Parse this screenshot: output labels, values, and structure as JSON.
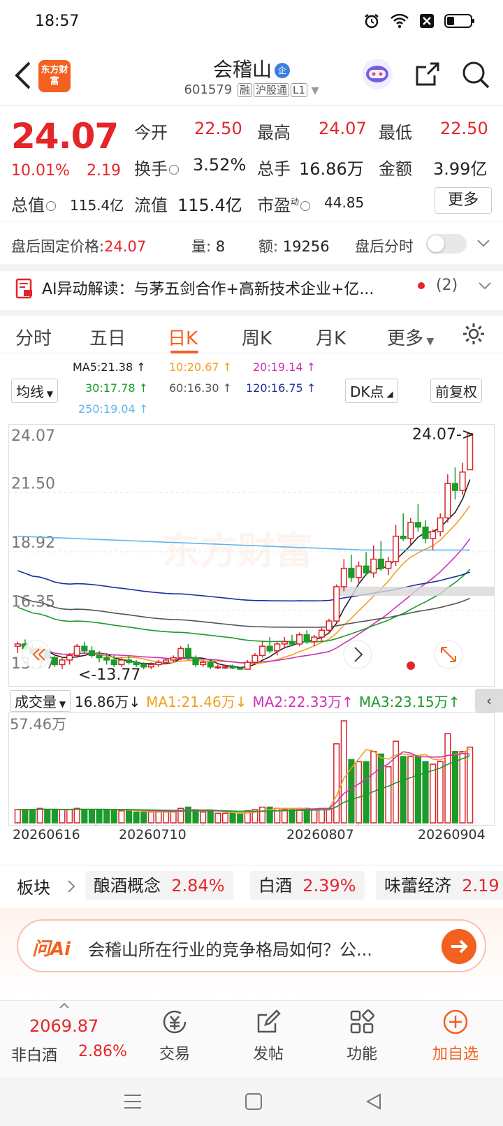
{
  "status": {
    "time": "18:57"
  },
  "header": {
    "brand": "东方财富",
    "name": "会稽山",
    "badge": "企",
    "code": "601579",
    "tags": [
      "融",
      "沪股通",
      "L1"
    ]
  },
  "quote": {
    "price": "24.07",
    "change_pct": "10.01%",
    "change": "2.19",
    "rows": [
      [
        {
          "label": "今开",
          "value": "22.50",
          "color": "red"
        },
        {
          "label": "最高",
          "value": "24.07",
          "color": "red"
        },
        {
          "label": "最低",
          "value": "22.50",
          "color": "red"
        }
      ],
      [
        {
          "label": "换手",
          "value": "3.52%",
          "color": "black"
        },
        {
          "label": "总手",
          "value": "16.86万",
          "color": "black"
        },
        {
          "label": "金额",
          "value": "3.99亿",
          "color": "black"
        }
      ],
      [
        {
          "label": "总值",
          "value": "115.4亿",
          "color": "black"
        },
        {
          "label": "流值",
          "value": "115.4亿",
          "color": "black"
        },
        {
          "label": "市盈",
          "value": "44.85",
          "color": "black"
        }
      ]
    ],
    "pe_sup": "动",
    "more": "更多"
  },
  "after_hours": {
    "label": "盘后固定价格:",
    "price": "24.07",
    "vol_label": "量:",
    "vol": "8",
    "amt_label": "额:",
    "amt": "19256",
    "toggle_label": "盘后分时"
  },
  "ai_banner": {
    "text": "AI异动解读：与茅五剑合作+高新技术企业+亿...",
    "count": "(2)"
  },
  "tabs": [
    "分时",
    "五日",
    "日K",
    "周K",
    "月K",
    "更多"
  ],
  "active_tab": "日K",
  "ma_legend": {
    "selector": "均线",
    "items": [
      {
        "text": "MA5:21.38",
        "color": "#222222"
      },
      {
        "text": "10:20.67",
        "color": "#f0a020"
      },
      {
        "text": "20:19.14",
        "color": "#d230b4"
      },
      {
        "text": "30:17.78",
        "color": "#1b9b2a"
      },
      {
        "text": "60:16.30",
        "color": "#555555"
      },
      {
        "text": "120:16.75",
        "color": "#1c2fa0"
      },
      {
        "text": "250:19.04",
        "color": "#5fb6ea"
      }
    ],
    "dk": "DK点",
    "adjust": "前复权"
  },
  "chart_data": {
    "type": "candlestick",
    "y_ticks": [
      "24.07",
      "21.50",
      "18.92",
      "16.35",
      "13.77"
    ],
    "ylim": [
      13.77,
      24.07
    ],
    "max_label": "24.07->",
    "min_label": "<-13.77",
    "watermark": "东方财富",
    "x_dates": [
      "20260616",
      "20260710",
      "20260807",
      "20260904"
    ],
    "candles": [
      [
        14.8,
        15.0,
        14.5,
        14.9
      ],
      [
        14.9,
        15.1,
        14.6,
        14.7
      ],
      [
        14.7,
        14.9,
        14.4,
        14.5
      ],
      [
        14.5,
        14.8,
        14.2,
        14.6
      ],
      [
        14.6,
        14.7,
        14.2,
        14.3
      ],
      [
        14.3,
        14.4,
        13.9,
        14.0
      ],
      [
        14.0,
        14.3,
        13.8,
        14.2
      ],
      [
        14.2,
        14.5,
        14.0,
        14.4
      ],
      [
        14.4,
        14.9,
        14.3,
        14.8
      ],
      [
        14.8,
        15.0,
        14.5,
        14.6
      ],
      [
        14.6,
        14.8,
        14.3,
        14.4
      ],
      [
        14.4,
        14.6,
        14.1,
        14.3
      ],
      [
        14.3,
        14.5,
        14.0,
        14.2
      ],
      [
        14.2,
        14.4,
        13.9,
        14.0
      ],
      [
        14.0,
        14.3,
        13.9,
        14.2
      ],
      [
        14.2,
        14.4,
        14.0,
        14.1
      ],
      [
        14.1,
        14.2,
        13.9,
        14.0
      ],
      [
        14.0,
        14.1,
        13.8,
        13.9
      ],
      [
        13.9,
        14.1,
        13.8,
        14.0
      ],
      [
        14.0,
        14.2,
        13.9,
        14.1
      ],
      [
        14.1,
        14.3,
        14.0,
        14.2
      ],
      [
        14.2,
        14.4,
        14.1,
        14.3
      ],
      [
        14.3,
        14.8,
        14.2,
        14.7
      ],
      [
        14.7,
        14.9,
        14.2,
        14.3
      ],
      [
        14.3,
        14.4,
        13.9,
        14.0
      ],
      [
        14.0,
        14.2,
        13.9,
        14.1
      ],
      [
        14.1,
        14.2,
        13.8,
        13.9
      ],
      [
        13.9,
        14.0,
        13.8,
        13.9
      ],
      [
        13.9,
        14.0,
        13.8,
        13.9
      ],
      [
        13.9,
        14.0,
        13.8,
        13.85
      ],
      [
        13.85,
        13.9,
        13.77,
        13.8
      ],
      [
        13.8,
        14.2,
        13.79,
        14.1
      ],
      [
        14.1,
        14.5,
        14.0,
        14.4
      ],
      [
        14.4,
        15.0,
        14.3,
        14.8
      ],
      [
        14.8,
        15.2,
        14.5,
        14.6
      ],
      [
        14.6,
        15.0,
        14.4,
        14.9
      ],
      [
        14.9,
        15.2,
        14.7,
        15.0
      ],
      [
        15.0,
        15.3,
        14.8,
        14.9
      ],
      [
        14.9,
        15.4,
        14.8,
        15.3
      ],
      [
        15.3,
        15.5,
        14.9,
        15.0
      ],
      [
        15.0,
        15.3,
        14.8,
        15.2
      ],
      [
        15.2,
        15.6,
        15.0,
        15.5
      ],
      [
        15.5,
        16.0,
        15.4,
        15.9
      ],
      [
        15.9,
        17.5,
        15.8,
        17.4
      ],
      [
        17.4,
        18.6,
        17.2,
        18.2
      ],
      [
        18.2,
        18.8,
        17.6,
        17.8
      ],
      [
        17.8,
        18.5,
        17.5,
        18.3
      ],
      [
        18.3,
        18.9,
        17.9,
        18.0
      ],
      [
        18.0,
        19.2,
        17.8,
        18.6
      ],
      [
        18.6,
        19.4,
        18.1,
        18.2
      ],
      [
        18.2,
        18.7,
        17.9,
        18.5
      ],
      [
        18.5,
        20.1,
        18.3,
        19.6
      ],
      [
        19.6,
        20.6,
        19.4,
        19.5
      ],
      [
        19.5,
        20.4,
        19.2,
        20.2
      ],
      [
        20.2,
        21.0,
        19.8,
        20.0
      ],
      [
        20.0,
        20.3,
        19.3,
        19.5
      ],
      [
        19.5,
        19.9,
        19.0,
        19.8
      ],
      [
        19.8,
        20.6,
        19.6,
        20.4
      ],
      [
        20.4,
        22.3,
        20.2,
        21.9
      ],
      [
        21.9,
        22.6,
        21.2,
        21.6
      ],
      [
        21.6,
        22.8,
        21.4,
        22.4
      ],
      [
        22.5,
        24.07,
        22.5,
        24.07
      ]
    ],
    "volume": {
      "label": "成交量",
      "current": "16.86万",
      "ma1": "MA1:21.46万",
      "ma2": "MA2:22.33万",
      "ma3": "MA3:23.15万",
      "max_label": "57.46万"
    }
  },
  "sector": {
    "label": "板块",
    "chips": [
      {
        "name": "酿酒概念",
        "pct": "2.84%"
      },
      {
        "name": "白酒",
        "pct": "2.39%"
      },
      {
        "name": "味蕾经济",
        "pct": "2.19"
      }
    ]
  },
  "ask_ai": {
    "logo": "问Ai",
    "text": "会稽山所在行业的竞争格局如何？公..."
  },
  "bottom_bar": {
    "index_value": "2069.87",
    "index_name": "非白酒",
    "index_pct": "2.86%",
    "items": [
      "交易",
      "发帖",
      "功能",
      "加自选"
    ]
  }
}
